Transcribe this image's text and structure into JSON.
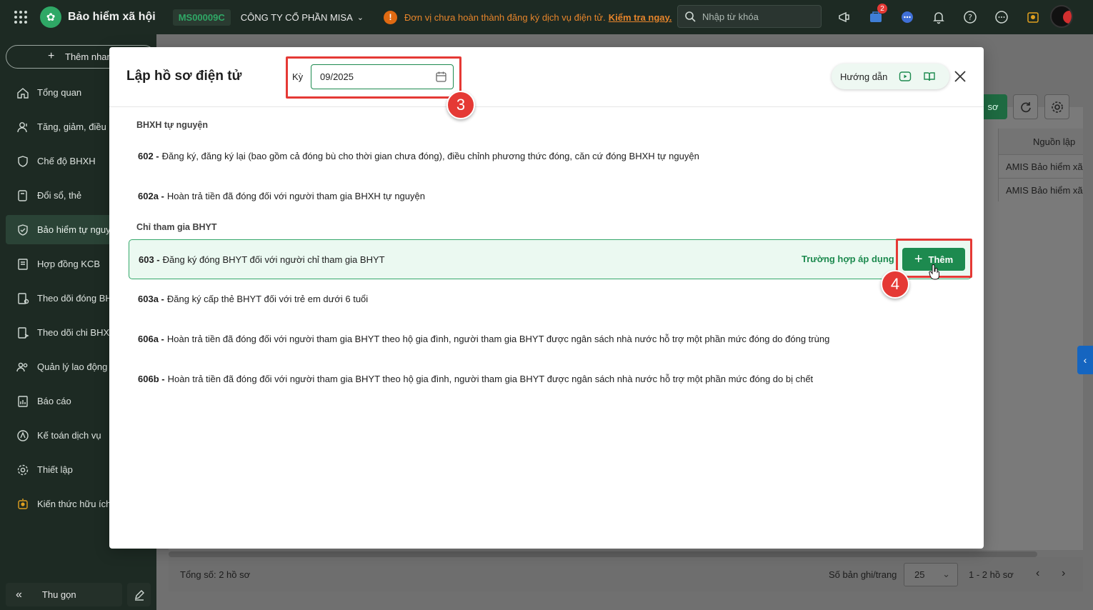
{
  "topbar": {
    "app_name": "Bảo hiểm xã hội",
    "unit_code": "MS00009C",
    "company": "CÔNG TY CỔ PHẦN MISA",
    "warning_text": "Đơn vị chưa hoàn thành đăng ký dịch vụ điện tử.",
    "warning_link": "Kiểm tra ngay.",
    "search_placeholder": "Nhập từ khóa",
    "cart_badge": "2"
  },
  "sidebar": {
    "quick_add": "Thêm nhanh",
    "items": [
      {
        "label": "Tổng quan",
        "icon": "home-icon"
      },
      {
        "label": "Tăng, giảm, điều chỉnh",
        "icon": "user-icon"
      },
      {
        "label": "Chế độ BHXH",
        "icon": "shield-icon"
      },
      {
        "label": "Đổi sổ, thẻ",
        "icon": "card-icon"
      },
      {
        "label": "Bảo hiểm tự nguyện",
        "icon": "shield-check-icon"
      },
      {
        "label": "Hợp đồng KCB",
        "icon": "contract-icon"
      },
      {
        "label": "Theo dõi đóng BHXH",
        "icon": "track-icon"
      },
      {
        "label": "Theo dõi chi BHXH",
        "icon": "track-pay-icon"
      },
      {
        "label": "Quản lý lao động",
        "icon": "people-icon"
      },
      {
        "label": "Báo cáo",
        "icon": "report-icon"
      },
      {
        "label": "Kế toán dịch vụ",
        "icon": "accounting-icon"
      },
      {
        "label": "Thiết lập",
        "icon": "gear-icon"
      },
      {
        "label": "Kiến thức hữu ích",
        "icon": "bulb-icon"
      }
    ],
    "active_index": 4,
    "collapse": "Thu gọn"
  },
  "background": {
    "button_label": "sơ",
    "column_header": "Nguồn lập",
    "rows": [
      "AMIS Bảo hiểm xã hội",
      "AMIS Bảo hiểm xã hội"
    ],
    "total": "Tổng số: 2 hồ sơ",
    "per_page_label": "Số bản ghi/trang",
    "per_page_value": "25",
    "range": "1 - 2 hồ sơ"
  },
  "modal": {
    "title": "Lập hồ sơ điện tử",
    "period_label": "Kỳ",
    "period_value": "09/2025",
    "guide_label": "Hướng dẫn",
    "groups": [
      {
        "title": "BHXH tự nguyện",
        "items": [
          {
            "code": "602 -",
            "text": "Đăng ký, đăng ký lại (bao gồm cả đóng bù cho thời gian chưa đóng), điều chỉnh phương thức đóng, căn cứ đóng BHXH tự nguyện"
          },
          {
            "code": "602a -",
            "text": "Hoàn trả tiền đã đóng đối với người tham gia BHXH tự nguyện"
          }
        ]
      },
      {
        "title": "Chỉ tham gia BHYT",
        "items": [
          {
            "code": "603 -",
            "text": "Đăng ký đóng BHYT đối với người chỉ tham gia BHYT"
          },
          {
            "code": "603a -",
            "text": "Đăng ký cấp thẻ BHYT đối với trẻ em dưới 6 tuổi"
          },
          {
            "code": "606a -",
            "text": "Hoàn trả tiền đã đóng đối với người tham gia BHYT theo hộ gia đình, người tham gia BHYT được ngân sách nhà nước hỗ trợ một phần mức đóng do đóng trùng"
          },
          {
            "code": "606b -",
            "text": "Hoàn trả tiền đã đóng đối với người tham gia BHYT theo hộ gia đình, người tham gia BHYT được ngân sách nhà nước hỗ trợ một phần mức đóng do bị chết"
          }
        ]
      }
    ],
    "apply_link": "Trường hợp áp dụng",
    "add_button": "Thêm"
  },
  "steps": [
    "3",
    "4"
  ],
  "colors": {
    "primary": "#1d8a4f",
    "highlight": "#e53935",
    "sidebar_bg": "#1d2a23",
    "warning": "#e5842b"
  }
}
